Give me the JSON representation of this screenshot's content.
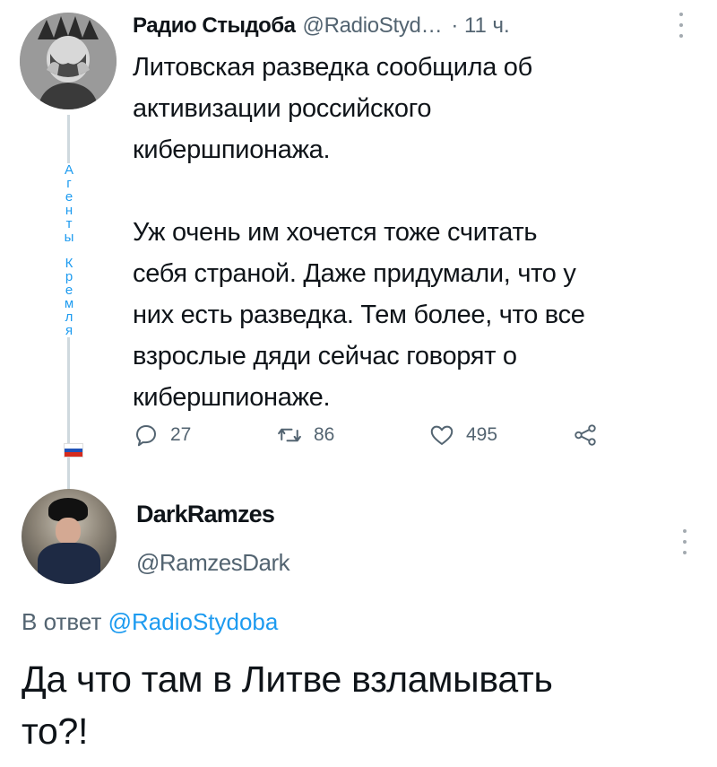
{
  "tweet": {
    "author_name": "Радио Стыдоба",
    "author_handle": "@RadioStyd…",
    "time": "· 11 ч.",
    "paragraphs": [
      [
        "Литовская разведка сообщила об",
        "активизации российского",
        "кибершпионажа."
      ],
      [
        "Уж очень им хочется тоже считать",
        "себя страной. Даже придумали, что у",
        "них есть разведка. Тем более, что все",
        "взрослые дяди сейчас говорят о",
        "кибершпионаже."
      ]
    ],
    "replies": "27",
    "retweets": "86",
    "likes": "495"
  },
  "thread_label": {
    "word1": [
      "А",
      "г",
      "е",
      "н",
      "т",
      "ы"
    ],
    "word2": [
      "К",
      "р",
      "е",
      "м",
      "л",
      "я"
    ]
  },
  "flag_colors": [
    "#ffffff",
    "#2052b8",
    "#d52b1e"
  ],
  "reply": {
    "author_name": "DarkRamzes",
    "author_handle": "@RamzesDark",
    "reply_prefix": "В ответ",
    "reply_target": "@RadioStydoba",
    "text_lines": [
      "Да что там в Литве взламывать",
      "то?!"
    ]
  },
  "icons": {
    "reply": "comment-icon",
    "retweet": "retweet-icon",
    "like": "heart-icon",
    "share": "share-icon",
    "more": "more-vertical-icon"
  },
  "colors": {
    "accent": "#1d9bf0",
    "text": "#0f1419",
    "secondary": "#536471"
  }
}
